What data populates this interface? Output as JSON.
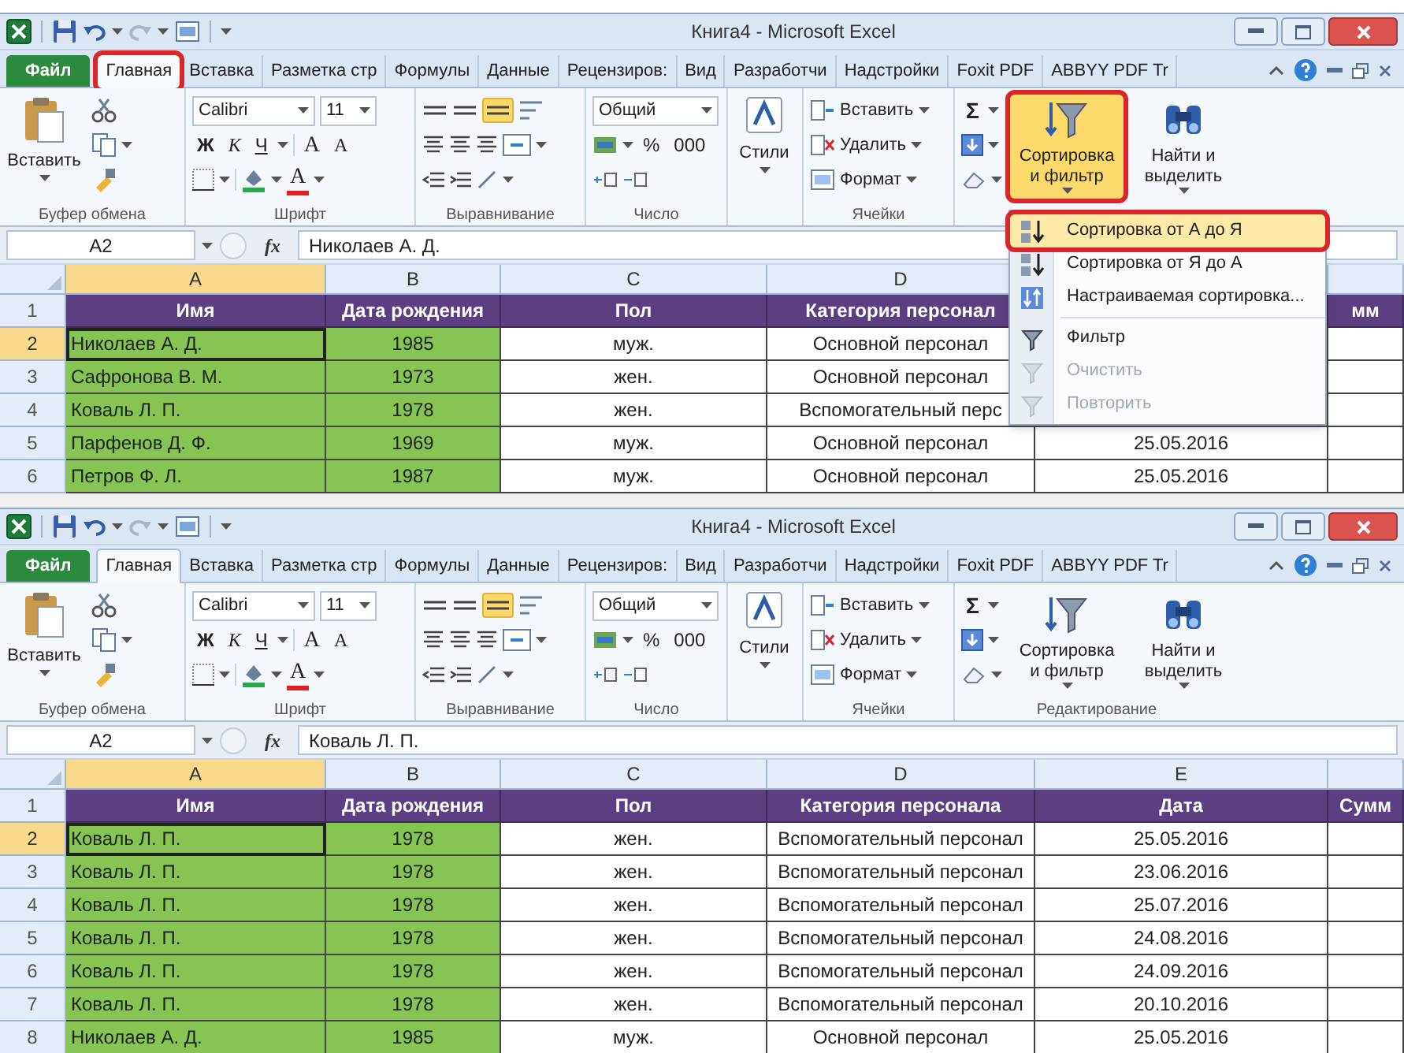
{
  "windows": [
    {
      "title": "Книга4 - Microsoft Excel",
      "tabs": [
        {
          "label": "Файл",
          "kind": "file",
          "selected": false,
          "annotated": false
        },
        {
          "label": "Главная",
          "kind": "tab",
          "selected": true,
          "annotated": true
        },
        {
          "label": "Вставка",
          "kind": "tab",
          "selected": false,
          "annotated": false
        },
        {
          "label": "Разметка стр",
          "kind": "tab",
          "selected": false,
          "annotated": false
        },
        {
          "label": "Формулы",
          "kind": "tab",
          "selected": false,
          "annotated": false
        },
        {
          "label": "Данные",
          "kind": "tab",
          "selected": false,
          "annotated": false
        },
        {
          "label": "Рецензиров:",
          "kind": "tab",
          "selected": false,
          "annotated": false
        },
        {
          "label": "Вид",
          "kind": "tab",
          "selected": false,
          "annotated": false
        },
        {
          "label": "Разработчи",
          "kind": "tab",
          "selected": false,
          "annotated": false
        },
        {
          "label": "Надстройки",
          "kind": "tab",
          "selected": false,
          "annotated": false
        },
        {
          "label": "Foxit PDF",
          "kind": "tab",
          "selected": false,
          "annotated": false
        },
        {
          "label": "ABBYY PDF Tr",
          "kind": "tab",
          "selected": false,
          "annotated": false
        }
      ],
      "ribbon": {
        "clipboard": {
          "paste": "Вставить",
          "label": "Буфер обмена"
        },
        "font": {
          "name": "Calibri",
          "size": "11",
          "bold": "Ж",
          "italic": "К",
          "underline": "Ч",
          "grow": "A",
          "shrink": "A",
          "font_color_label": "A",
          "label": "Шрифт"
        },
        "alignment": {
          "label": "Выравнивание"
        },
        "number": {
          "format": "Общий",
          "percent": "%",
          "thousands": "000",
          "label": "Число"
        },
        "styles": {
          "button": "Стили"
        },
        "cells": {
          "insert": "Вставить",
          "delete": "Удалить",
          "format": "Формат",
          "label": "Ячейки"
        },
        "editing": {
          "sum": "Σ",
          "sort": "Сортировка и фильтр",
          "sort_pressed": true,
          "sort_annotated": true,
          "find": "Найти и выделить"
        }
      },
      "name_box": "A2",
      "function_label": "fx",
      "formula": "Николаев А. Д.",
      "columns": [
        {
          "letter": "A",
          "selected": true,
          "filled": true
        },
        {
          "letter": "B",
          "selected": false,
          "filled": true
        },
        {
          "letter": "C",
          "selected": false,
          "filled": false
        },
        {
          "letter": "D",
          "selected": false,
          "filled": false
        },
        {
          "selected": false,
          "filled": false
        },
        {
          "selected": false,
          "filled": false
        }
      ],
      "rows": [
        {
          "number": "1",
          "kind": "header",
          "selected": false,
          "cells": [
            "Имя",
            "Дата рождения",
            "Пол",
            "Категория персонал",
            null,
            "мм"
          ]
        },
        {
          "number": "2",
          "kind": "data",
          "selected": true,
          "cells": [
            "Николаев А. Д.",
            "1985",
            "муж.",
            "Основной персонал",
            null,
            null
          ]
        },
        {
          "number": "3",
          "kind": "data",
          "selected": false,
          "cells": [
            "Сафронова В. М.",
            "1973",
            "жен.",
            "Основной персонал",
            null,
            null
          ]
        },
        {
          "number": "4",
          "kind": "data",
          "selected": false,
          "cells": [
            "Коваль Л. П.",
            "1978",
            "жен.",
            "Вспомогательный перс",
            null,
            null
          ]
        },
        {
          "number": "5",
          "kind": "data",
          "selected": false,
          "cells": [
            "Парфенов Д. Ф.",
            "1969",
            "муж.",
            "Основной персонал",
            "25.05.2016",
            null
          ]
        },
        {
          "number": "6",
          "kind": "data",
          "selected": false,
          "cells": [
            "Петров Ф. Л.",
            "1987",
            "муж.",
            "Основной персонал",
            "25.05.2016",
            null
          ]
        }
      ],
      "menu": {
        "sections": [
          [
            {
              "label": "Сортировка от А до Я",
              "kind": "sort_asc",
              "selected": true,
              "disabled": false,
              "annotated": true
            },
            {
              "label": "Сортировка от Я до А",
              "kind": "sort_desc",
              "selected": false,
              "disabled": false,
              "annotated": false
            },
            {
              "label": "Настраиваемая сортировка...",
              "kind": "custom_sort",
              "selected": false,
              "disabled": false,
              "annotated": false
            }
          ],
          [
            {
              "label": "Фильтр",
              "kind": "filter",
              "selected": false,
              "disabled": false,
              "annotated": false
            },
            {
              "label": "Очистить",
              "kind": "clear",
              "selected": false,
              "disabled": true,
              "annotated": false
            },
            {
              "label": "Повторить",
              "kind": "reapply",
              "selected": false,
              "disabled": true,
              "annotated": false
            }
          ]
        ]
      }
    },
    {
      "title": "Книга4 - Microsoft Excel",
      "tabs": [
        {
          "label": "Файл",
          "kind": "file",
          "selected": false,
          "annotated": false
        },
        {
          "label": "Главная",
          "kind": "tab",
          "selected": true,
          "annotated": false
        },
        {
          "label": "Вставка",
          "kind": "tab",
          "selected": false,
          "annotated": false
        },
        {
          "label": "Разметка стр",
          "kind": "tab",
          "selected": false,
          "annotated": false
        },
        {
          "label": "Формулы",
          "kind": "tab",
          "selected": false,
          "annotated": false
        },
        {
          "label": "Данные",
          "kind": "tab",
          "selected": false,
          "annotated": false
        },
        {
          "label": "Рецензиров:",
          "kind": "tab",
          "selected": false,
          "annotated": false
        },
        {
          "label": "Вид",
          "kind": "tab",
          "selected": false,
          "annotated": false
        },
        {
          "label": "Разработчи",
          "kind": "tab",
          "selected": false,
          "annotated": false
        },
        {
          "label": "Надстройки",
          "kind": "tab",
          "selected": false,
          "annotated": false
        },
        {
          "label": "Foxit PDF",
          "kind": "tab",
          "selected": false,
          "annotated": false
        },
        {
          "label": "ABBYY PDF Tr",
          "kind": "tab",
          "selected": false,
          "annotated": false
        }
      ],
      "ribbon": {
        "clipboard": {
          "paste": "Вставить",
          "label": "Буфер обмена"
        },
        "font": {
          "name": "Calibri",
          "size": "11",
          "bold": "Ж",
          "italic": "К",
          "underline": "Ч",
          "grow": "A",
          "shrink": "A",
          "font_color_label": "A",
          "label": "Шрифт"
        },
        "alignment": {
          "label": "Выравнивание"
        },
        "number": {
          "format": "Общий",
          "percent": "%",
          "thousands": "000",
          "label": "Число"
        },
        "styles": {
          "button": "Стили"
        },
        "cells": {
          "insert": "Вставить",
          "delete": "Удалить",
          "format": "Формат",
          "label": "Ячейки"
        },
        "editing": {
          "sum": "Σ",
          "sort": "Сортировка и фильтр",
          "sort_pressed": false,
          "sort_annotated": false,
          "find": "Найти и выделить",
          "label": "Редактирование"
        }
      },
      "name_box": "A2",
      "function_label": "fx",
      "formula": "Коваль Л. П.",
      "columns": [
        {
          "letter": "A",
          "selected": true,
          "filled": true
        },
        {
          "letter": "B",
          "selected": false,
          "filled": true
        },
        {
          "letter": "C",
          "selected": false,
          "filled": false
        },
        {
          "letter": "D",
          "selected": false,
          "filled": false
        },
        {
          "letter": "E",
          "selected": false,
          "filled": false
        },
        {
          "selected": false,
          "filled": false
        }
      ],
      "rows": [
        {
          "number": "1",
          "kind": "header",
          "selected": false,
          "cells": [
            "Имя",
            "Дата рождения",
            "Пол",
            "Категория персонала",
            "Дата",
            "Сумм"
          ]
        },
        {
          "number": "2",
          "kind": "data",
          "selected": true,
          "cells": [
            "Коваль Л. П.",
            "1978",
            "жен.",
            "Вспомогательный персонал",
            "25.05.2016",
            null
          ]
        },
        {
          "number": "3",
          "kind": "data",
          "selected": false,
          "cells": [
            "Коваль Л. П.",
            "1978",
            "жен.",
            "Вспомогательный персонал",
            "23.06.2016",
            null
          ]
        },
        {
          "number": "4",
          "kind": "data",
          "selected": false,
          "cells": [
            "Коваль Л. П.",
            "1978",
            "жен.",
            "Вспомогательный персонал",
            "25.07.2016",
            null
          ]
        },
        {
          "number": "5",
          "kind": "data",
          "selected": false,
          "cells": [
            "Коваль Л. П.",
            "1978",
            "жен.",
            "Вспомогательный персонал",
            "24.08.2016",
            null
          ]
        },
        {
          "number": "6",
          "kind": "data",
          "selected": false,
          "cells": [
            "Коваль Л. П.",
            "1978",
            "жен.",
            "Вспомогательный персонал",
            "24.09.2016",
            null
          ]
        },
        {
          "number": "7",
          "kind": "data",
          "selected": false,
          "cells": [
            "Коваль Л. П.",
            "1978",
            "жен.",
            "Вспомогательный персонал",
            "20.10.2016",
            null
          ]
        },
        {
          "number": "8",
          "kind": "data",
          "selected": false,
          "cells": [
            "Николаев А. Д.",
            "1985",
            "муж.",
            "Основной персонал",
            "25.05.2016",
            null
          ]
        }
      ]
    }
  ]
}
